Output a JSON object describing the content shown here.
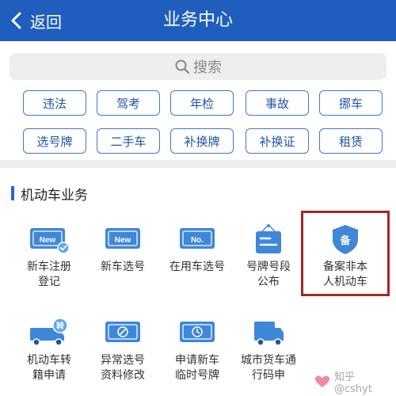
{
  "header": {
    "back_label": "返回",
    "title": "业务中心"
  },
  "search": {
    "placeholder": "搜索"
  },
  "quick_links": [
    "违法",
    "驾考",
    "年检",
    "事故",
    "挪车",
    "选号牌",
    "二手车",
    "补换牌",
    "补换证",
    "租赁"
  ],
  "section": {
    "title": "机动车业务"
  },
  "services": [
    {
      "line1": "新车注册",
      "line2": "登记",
      "icon": "new-car-register-icon",
      "icon_text": "New"
    },
    {
      "line1": "新车选号",
      "line2": "",
      "icon": "new-plate-icon",
      "icon_text": "New"
    },
    {
      "line1": "在用车选号",
      "line2": "",
      "icon": "number-plate-icon",
      "icon_text": "No."
    },
    {
      "line1": "号牌号段",
      "line2": "公布",
      "icon": "announcement-icon",
      "icon_text": ""
    },
    {
      "line1": "备案非本",
      "line2": "人机动车",
      "icon": "filing-shield-icon",
      "icon_text": "备"
    },
    {
      "line1": "机动车转",
      "line2": "籍申请",
      "icon": "transfer-truck-icon",
      "icon_text": "转"
    },
    {
      "line1": "异常选号",
      "line2": "资料修改",
      "icon": "edit-document-icon",
      "icon_text": ""
    },
    {
      "line1": "申请新车",
      "line2": "临时号牌",
      "icon": "temporary-plate-icon",
      "icon_text": ""
    },
    {
      "line1": "城市货车通",
      "line2": "行码申",
      "icon": "cargo-truck-icon",
      "icon_text": ""
    }
  ],
  "watermark": {
    "text": "知乎 @cshyt",
    "icon": "zhihu-heart-icon"
  },
  "colors": {
    "header": "#1f5ebd",
    "accent": "#2a67c9",
    "highlight": "#a4262a"
  }
}
